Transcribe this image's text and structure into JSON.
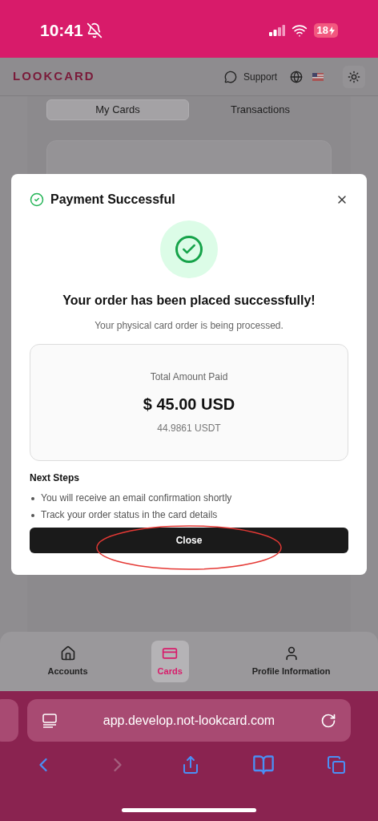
{
  "status_bar": {
    "time": "10:41",
    "battery": "18"
  },
  "header": {
    "logo": "LOOKCARD",
    "support": "Support"
  },
  "tabs": [
    {
      "label": "My Cards",
      "selected": true
    },
    {
      "label": "Transactions",
      "selected": false
    }
  ],
  "dialog": {
    "title": "Payment Successful",
    "heading": "Your order has been placed successfully!",
    "subtitle": "Your physical card order is being processed.",
    "amount_label": "Total Amount Paid",
    "amount": "$ 45.00 USD",
    "amount_crypto": "44.9861 USDT",
    "next_title": "Next Steps",
    "next_steps": [
      "You will receive an email confirmation shortly",
      "Track your order status in the card details"
    ],
    "button": "Close"
  },
  "bottom_nav": [
    {
      "label": "Accounts",
      "kind": "home",
      "selected": false
    },
    {
      "label": "Cards",
      "kind": "card",
      "selected": true
    },
    {
      "label": "Profile Information",
      "kind": "user",
      "selected": false
    }
  ],
  "browser": {
    "url": "app.develop.not-lookcard.com"
  }
}
